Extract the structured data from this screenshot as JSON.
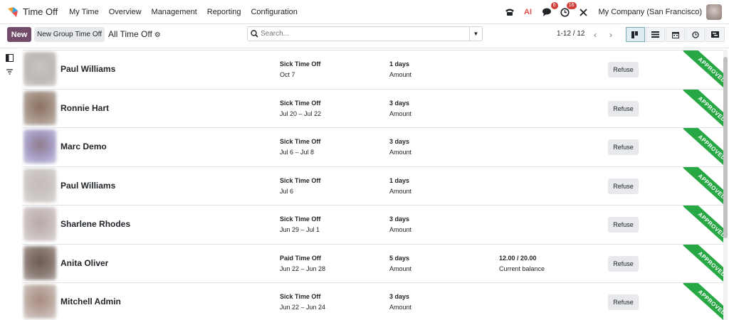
{
  "nav": {
    "app_title": "Time Off",
    "menu": [
      "My Time",
      "Overview",
      "Management",
      "Reporting",
      "Configuration"
    ],
    "messages_badge": "6",
    "activity_badge": "16",
    "company": "My Company (San Francisco)",
    "ai_label": "AI"
  },
  "control": {
    "new_label": "New",
    "group_label": "New Group Time Off",
    "view_title": "All Time Off",
    "search_placeholder": "Search...",
    "pager": "1-12 / 12"
  },
  "records": [
    {
      "name": "Paul Williams",
      "type": "Sick Time Off",
      "dates": "Oct 7",
      "duration": "1 days",
      "duration_label": "Amount",
      "balance": "",
      "balance_label": "",
      "action": "Refuse",
      "status": "APPROVED"
    },
    {
      "name": "Ronnie Hart",
      "type": "Sick Time Off",
      "dates": "Jul 20 – Jul 22",
      "duration": "3 days",
      "duration_label": "Amount",
      "balance": "",
      "balance_label": "",
      "action": "Refuse",
      "status": "APPROVED"
    },
    {
      "name": "Marc Demo",
      "type": "Sick Time Off",
      "dates": "Jul 6 – Jul 8",
      "duration": "3 days",
      "duration_label": "Amount",
      "balance": "",
      "balance_label": "",
      "action": "Refuse",
      "status": "APPROVED"
    },
    {
      "name": "Paul Williams",
      "type": "Sick Time Off",
      "dates": "Jul 6",
      "duration": "1 days",
      "duration_label": "Amount",
      "balance": "",
      "balance_label": "",
      "action": "Refuse",
      "status": "APPROVED"
    },
    {
      "name": "Sharlene Rhodes",
      "type": "Sick Time Off",
      "dates": "Jun 29 – Jul 1",
      "duration": "3 days",
      "duration_label": "Amount",
      "balance": "",
      "balance_label": "",
      "action": "Refuse",
      "status": "APPROVED"
    },
    {
      "name": "Anita Oliver",
      "type": "Paid Time Off",
      "dates": "Jun 22 – Jun 28",
      "duration": "5 days",
      "duration_label": "Amount",
      "balance": "12.00 / 20.00",
      "balance_label": "Current balance",
      "action": "Refuse",
      "status": "APPROVED"
    },
    {
      "name": "Mitchell Admin",
      "type": "Sick Time Off",
      "dates": "Jun 22 – Jun 24",
      "duration": "3 days",
      "duration_label": "Amount",
      "balance": "",
      "balance_label": "",
      "action": "Refuse",
      "status": "APPROVED"
    }
  ],
  "colors": {
    "primary": "#714b67",
    "approved_ribbon": "#28a745",
    "badge": "#d23f3a"
  },
  "icons": [
    "brand-icon",
    "phone-icon",
    "ai-icon",
    "chat-icon",
    "clock-icon",
    "tools-icon",
    "gear-icon",
    "search-icon",
    "caret-down-icon",
    "chevron-left-icon",
    "chevron-right-icon",
    "kanban-view-icon",
    "list-view-icon",
    "calendar-view-icon",
    "activity-view-icon",
    "gantt-view-icon",
    "sidebar-toggle-icon",
    "filter-icon"
  ]
}
